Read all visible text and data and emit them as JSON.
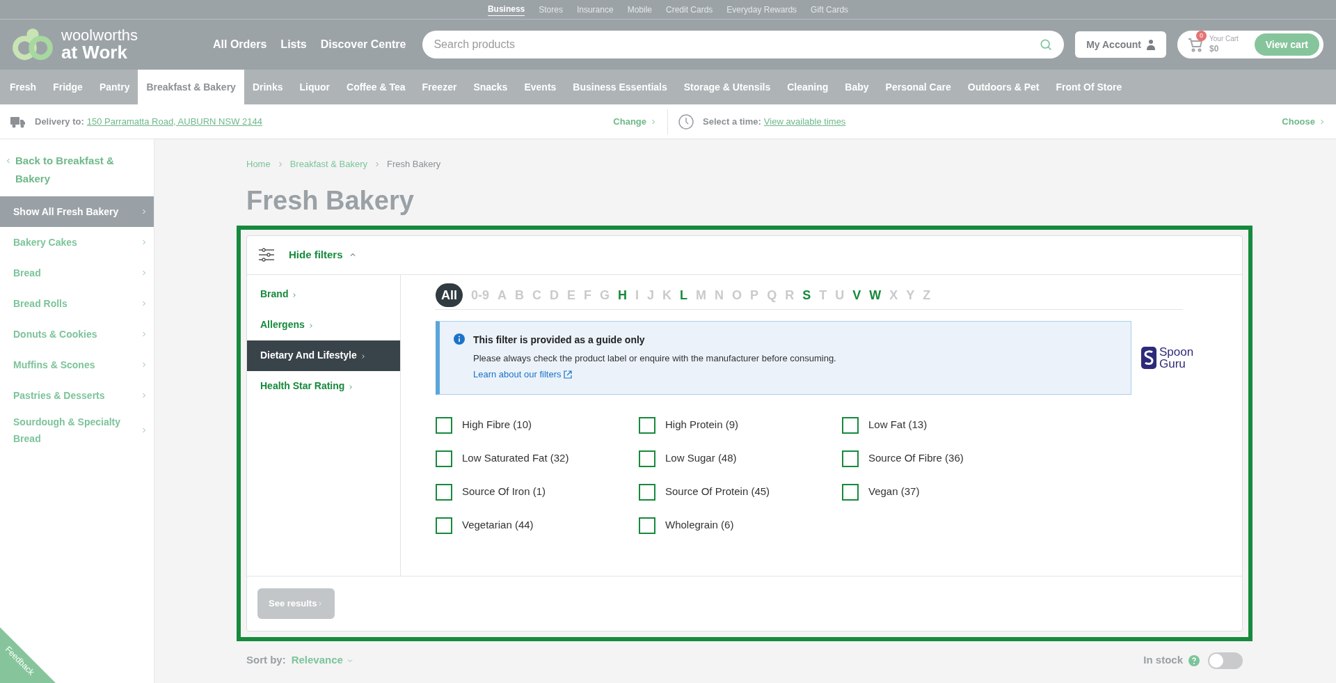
{
  "utility_nav": [
    {
      "label": "Business",
      "selected": true
    },
    {
      "label": "Stores",
      "selected": false
    },
    {
      "label": "Insurance",
      "selected": false
    },
    {
      "label": "Mobile",
      "selected": false
    },
    {
      "label": "Credit Cards",
      "selected": false
    },
    {
      "label": "Everyday Rewards",
      "selected": false
    },
    {
      "label": "Gift Cards",
      "selected": false
    }
  ],
  "logo": {
    "line1": "woolworths",
    "line2": "at Work"
  },
  "header_links": [
    "All Orders",
    "Lists",
    "Discover Centre"
  ],
  "search": {
    "placeholder": "Search products"
  },
  "account": {
    "label": "My Account"
  },
  "cart": {
    "badge": "0",
    "label": "Your Cart",
    "total": "$0",
    "button": "View cart"
  },
  "categories": [
    {
      "label": "Fresh",
      "selected": false
    },
    {
      "label": "Fridge",
      "selected": false
    },
    {
      "label": "Pantry",
      "selected": false
    },
    {
      "label": "Breakfast & Bakery",
      "selected": true
    },
    {
      "label": "Drinks",
      "selected": false
    },
    {
      "label": "Liquor",
      "selected": false
    },
    {
      "label": "Coffee & Tea",
      "selected": false
    },
    {
      "label": "Freezer",
      "selected": false
    },
    {
      "label": "Snacks",
      "selected": false
    },
    {
      "label": "Events",
      "selected": false
    },
    {
      "label": "Business Essentials",
      "selected": false
    },
    {
      "label": "Storage & Utensils",
      "selected": false
    },
    {
      "label": "Cleaning",
      "selected": false
    },
    {
      "label": "Baby",
      "selected": false
    },
    {
      "label": "Personal Care",
      "selected": false
    },
    {
      "label": "Outdoors & Pet",
      "selected": false
    },
    {
      "label": "Front Of Store",
      "selected": false
    }
  ],
  "delivery": {
    "label": "Delivery to:",
    "address": "150 Parramatta Road, AUBURN NSW 2144",
    "action": "Change"
  },
  "time": {
    "label": "Select a time:",
    "link": "View available times",
    "action": "Choose"
  },
  "sidebar": {
    "back": "Back to Breakfast & Bakery",
    "items": [
      {
        "label": "Show All Fresh Bakery",
        "selected": true
      },
      {
        "label": "Bakery Cakes",
        "selected": false
      },
      {
        "label": "Bread",
        "selected": false
      },
      {
        "label": "Bread Rolls",
        "selected": false
      },
      {
        "label": "Donuts & Cookies",
        "selected": false
      },
      {
        "label": "Muffins & Scones",
        "selected": false
      },
      {
        "label": "Pastries & Desserts",
        "selected": false
      },
      {
        "label": "Sourdough & Specialty Bread",
        "selected": false
      }
    ]
  },
  "breadcrumb": [
    "Home",
    "Breakfast & Bakery",
    "Fresh Bakery"
  ],
  "page_title": "Fresh Bakery",
  "filters": {
    "toggle": "Hide filters",
    "expanded": true,
    "groups": [
      {
        "label": "Brand",
        "selected": false
      },
      {
        "label": "Allergens",
        "selected": false
      },
      {
        "label": "Dietary And Lifestyle",
        "selected": true
      },
      {
        "label": "Health Star Rating",
        "selected": false
      }
    ],
    "letters": [
      {
        "label": "All",
        "selected": true,
        "disabled": false
      },
      {
        "label": "0-9",
        "selected": false,
        "disabled": true
      },
      {
        "label": "A",
        "selected": false,
        "disabled": true
      },
      {
        "label": "B",
        "selected": false,
        "disabled": true
      },
      {
        "label": "C",
        "selected": false,
        "disabled": true
      },
      {
        "label": "D",
        "selected": false,
        "disabled": true
      },
      {
        "label": "E",
        "selected": false,
        "disabled": true
      },
      {
        "label": "F",
        "selected": false,
        "disabled": true
      },
      {
        "label": "G",
        "selected": false,
        "disabled": true
      },
      {
        "label": "H",
        "selected": false,
        "disabled": false
      },
      {
        "label": "I",
        "selected": false,
        "disabled": true
      },
      {
        "label": "J",
        "selected": false,
        "disabled": true
      },
      {
        "label": "K",
        "selected": false,
        "disabled": true
      },
      {
        "label": "L",
        "selected": false,
        "disabled": false
      },
      {
        "label": "M",
        "selected": false,
        "disabled": true
      },
      {
        "label": "N",
        "selected": false,
        "disabled": true
      },
      {
        "label": "O",
        "selected": false,
        "disabled": true
      },
      {
        "label": "P",
        "selected": false,
        "disabled": true
      },
      {
        "label": "Q",
        "selected": false,
        "disabled": true
      },
      {
        "label": "R",
        "selected": false,
        "disabled": true
      },
      {
        "label": "S",
        "selected": false,
        "disabled": false
      },
      {
        "label": "T",
        "selected": false,
        "disabled": true
      },
      {
        "label": "U",
        "selected": false,
        "disabled": true
      },
      {
        "label": "V",
        "selected": false,
        "disabled": false
      },
      {
        "label": "W",
        "selected": false,
        "disabled": false
      },
      {
        "label": "X",
        "selected": false,
        "disabled": true
      },
      {
        "label": "Y",
        "selected": false,
        "disabled": true
      },
      {
        "label": "Z",
        "selected": false,
        "disabled": true
      }
    ],
    "notice": {
      "title": "This filter is provided as a guide only",
      "text": "Please always check the product label or enquire with the manufacturer before consuming.",
      "link": "Learn about our filters"
    },
    "partner_logo": {
      "line1": "Spoon",
      "line2": "Guru"
    },
    "options": [
      {
        "label": "High Fibre (10)",
        "checked": false
      },
      {
        "label": "High Protein (9)",
        "checked": false
      },
      {
        "label": "Low Fat (13)",
        "checked": false
      },
      {
        "label": "Low Saturated Fat (32)",
        "checked": false
      },
      {
        "label": "Low Sugar (48)",
        "checked": false
      },
      {
        "label": "Source Of Fibre (36)",
        "checked": false
      },
      {
        "label": "Source Of Iron (1)",
        "checked": false
      },
      {
        "label": "Source Of Protein (45)",
        "checked": false
      },
      {
        "label": "Vegan (37)",
        "checked": false
      },
      {
        "label": "Vegetarian (44)",
        "checked": false
      },
      {
        "label": "Wholegrain (6)",
        "checked": false
      }
    ],
    "submit": {
      "label": "See results",
      "disabled": true
    }
  },
  "sort": {
    "label": "Sort by:",
    "value": "Relevance"
  },
  "in_stock": {
    "label": "In stock",
    "on": false
  },
  "feedback": "Feedback"
}
